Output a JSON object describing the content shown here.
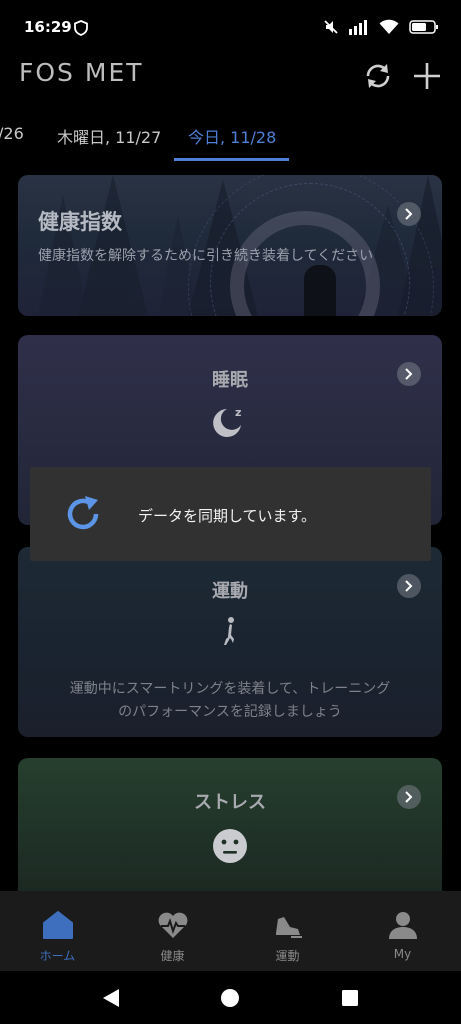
{
  "status_bar": {
    "time": "16:29"
  },
  "header": {
    "logo": "FOS MET"
  },
  "date_tabs": [
    {
      "label": "/26"
    },
    {
      "label": "木曜日, 11/27"
    },
    {
      "label": "今日, 11/28",
      "active": true
    }
  ],
  "cards": {
    "health_index": {
      "title": "健康指数",
      "subtitle": "健康指数を解除するために引き続き装着してください"
    },
    "sleep": {
      "title": "睡眠"
    },
    "exercise": {
      "title": "運動",
      "description_line1": "運動中にスマートリングを装着して、トレーニング",
      "description_line2": "のパフォーマンスを記録しましょう"
    },
    "stress": {
      "title": "ストレス"
    }
  },
  "dialog": {
    "message": "データを同期しています。"
  },
  "bottom_nav": [
    {
      "label": "ホーム",
      "icon": "home-icon",
      "active": true
    },
    {
      "label": "健康",
      "icon": "heart-pulse-icon"
    },
    {
      "label": "運動",
      "icon": "running-shoe-icon"
    },
    {
      "label": "My",
      "icon": "person-icon"
    }
  ],
  "colors": {
    "accent": "#4f7fd6",
    "nav_active": "#3e6fbf",
    "background": "#000000"
  }
}
